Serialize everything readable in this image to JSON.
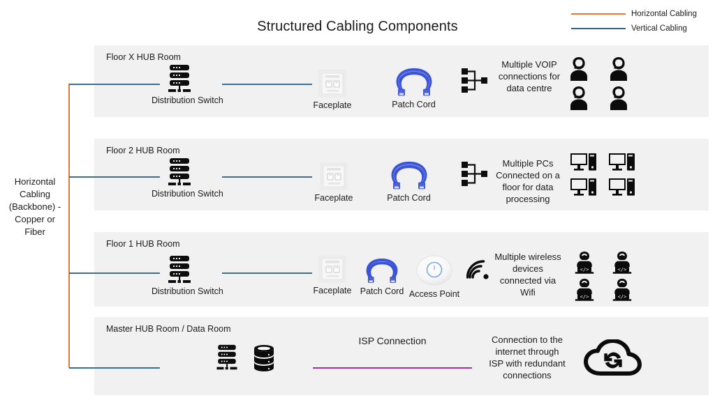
{
  "title": "Structured Cabling Components",
  "legend": {
    "items": [
      {
        "label": "Horizontal Cabling",
        "color": "#e2783c",
        "icon": "line-swatch-icon"
      },
      {
        "label": "Vertical Cabling",
        "color": "#32627f",
        "icon": "line-swatch-icon"
      }
    ]
  },
  "backbone": {
    "label": "Horizontal Cabling (Backbone) - Copper or Fiber",
    "color": "#e2783c"
  },
  "colors": {
    "vertical_cabling": "#3b6e8f",
    "horizontal_cabling": "#e2783c",
    "isp_connection": "#a8339b",
    "panel_background": "#f1f1f1",
    "patch_cord": "#3b54d6",
    "access_point_ring": "#7aa7e8"
  },
  "rows": [
    {
      "label": "Floor X HUB Room",
      "switch_caption": "Distribution Switch",
      "faceplate_caption": "Faceplate",
      "patchcord_caption": "Patch Cord",
      "note": "Multiple VOIP connections for data centre",
      "endpoint_icon": "headset-agent-icon",
      "endpoint_count": 4
    },
    {
      "label": "Floor 2 HUB Room",
      "switch_caption": "Distribution Switch",
      "faceplate_caption": "Faceplate",
      "patchcord_caption": "Patch Cord",
      "note": "Multiple PCs Connected on a floor for data processing",
      "endpoint_icon": "desktop-computer-icon",
      "endpoint_count": 4
    },
    {
      "label": "Floor 1 HUB Room",
      "switch_caption": "Distribution Switch",
      "faceplate_caption": "Faceplate",
      "patchcord_caption": "Patch Cord",
      "accesspoint_caption": "Access Point",
      "note": "Multiple wireless devices connected via Wifi",
      "endpoint_icon": "laptop-user-icon",
      "endpoint_count": 4
    },
    {
      "label": "Master HUB Room / Data Room",
      "isp_label": "ISP Connection",
      "note": "Connection to the internet through ISP with redundant connections",
      "endpoint_icon": "cloud-sync-icon"
    }
  ]
}
